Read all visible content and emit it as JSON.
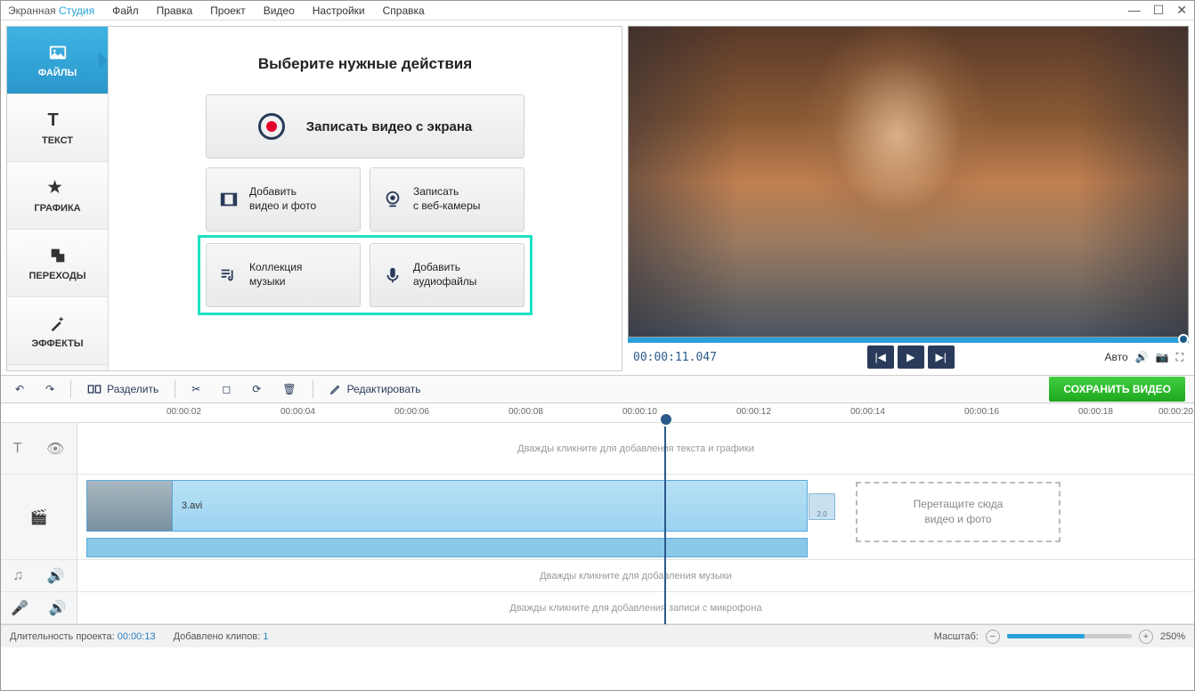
{
  "app": {
    "title_a": "Экранная",
    "title_b": "Студия"
  },
  "menu": [
    "Файл",
    "Правка",
    "Проект",
    "Видео",
    "Настройки",
    "Справка"
  ],
  "tabs": [
    {
      "label": "ФАЙЛЫ"
    },
    {
      "label": "ТЕКСТ"
    },
    {
      "label": "ГРАФИКА"
    },
    {
      "label": "ПЕРЕХОДЫ"
    },
    {
      "label": "ЭФФЕКТЫ"
    }
  ],
  "content": {
    "title": "Выберите нужные действия",
    "record_screen": "Записать видео с экрана",
    "add_media_l1": "Добавить",
    "add_media_l2": "видео и фото",
    "webcam_l1": "Записать",
    "webcam_l2": "с веб-камеры",
    "music_l1": "Коллекция",
    "music_l2": "музыки",
    "audio_l1": "Добавить",
    "audio_l2": "аудиофайлы"
  },
  "preview": {
    "time": "00:00:11.047",
    "auto": "Авто"
  },
  "toolbar": {
    "split": "Разделить",
    "edit": "Редактировать",
    "save": "СОХРАНИТЬ ВИДЕО"
  },
  "ruler": [
    "00:00:02",
    "00:00:04",
    "00:00:06",
    "00:00:08",
    "00:00:10",
    "00:00:12",
    "00:00:14",
    "00:00:16",
    "00:00:18",
    "00:00:20"
  ],
  "tracks": {
    "text_hint": "Дважды кликните для добавления текста и графики",
    "clip_name": "3.avi",
    "clip_trans": "2.0",
    "drop_hint_l1": "Перетащите сюда",
    "drop_hint_l2": "видео и фото",
    "music_hint": "Дважды кликните для добавления музыки",
    "mic_hint": "Дважды кликните для добавления записи с микрофона"
  },
  "status": {
    "duration_label": "Длительность проекта:",
    "duration_value": "00:00:13",
    "clips_label": "Добавлено клипов:",
    "clips_value": "1",
    "zoom_label": "Масштаб:",
    "zoom_value": "250%"
  }
}
